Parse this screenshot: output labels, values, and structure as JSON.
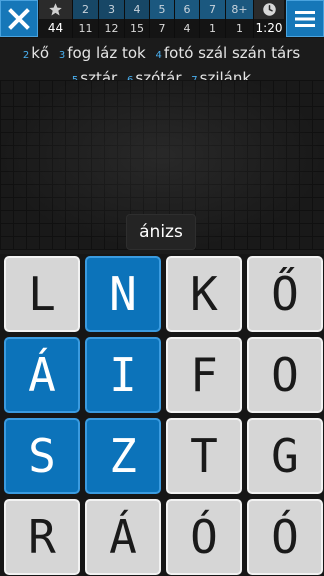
{
  "stats": [
    {
      "header": "★",
      "value": "44"
    },
    {
      "header": "2",
      "value": "11"
    },
    {
      "header": "3",
      "value": "12"
    },
    {
      "header": "4",
      "value": "15"
    },
    {
      "header": "5",
      "value": "7"
    },
    {
      "header": "6",
      "value": "4"
    },
    {
      "header": "7",
      "value": "1"
    },
    {
      "header": "8+",
      "value": "1"
    },
    {
      "header": "clock",
      "value": "1:20"
    }
  ],
  "found_words": {
    "line1": [
      {
        "num": "2",
        "words": "kő"
      },
      {
        "num": "3",
        "words": "fog láz tok"
      },
      {
        "num": "4",
        "words": "fotó szál szán társ"
      }
    ],
    "line2": [
      {
        "num": "5",
        "words": "sztár"
      },
      {
        "num": "6",
        "words": "szótár"
      },
      {
        "num": "7",
        "words": "szilánk"
      }
    ]
  },
  "current_word": "ánizs",
  "board": [
    [
      {
        "letter": "L",
        "selected": false
      },
      {
        "letter": "N",
        "selected": true
      },
      {
        "letter": "K",
        "selected": false
      },
      {
        "letter": "Ő",
        "selected": false
      }
    ],
    [
      {
        "letter": "Á",
        "selected": true
      },
      {
        "letter": "I",
        "selected": true
      },
      {
        "letter": "F",
        "selected": false
      },
      {
        "letter": "O",
        "selected": false
      }
    ],
    [
      {
        "letter": "S",
        "selected": true
      },
      {
        "letter": "Z",
        "selected": true
      },
      {
        "letter": "T",
        "selected": false
      },
      {
        "letter": "G",
        "selected": false
      }
    ],
    [
      {
        "letter": "R",
        "selected": false
      },
      {
        "letter": "Á",
        "selected": false
      },
      {
        "letter": "Ó",
        "selected": false
      },
      {
        "letter": "Ó",
        "selected": false
      }
    ]
  ],
  "colors": {
    "accent": "#0c73ba",
    "tile_light": "#d6d6d6",
    "word_number": "#4ab0f0"
  }
}
